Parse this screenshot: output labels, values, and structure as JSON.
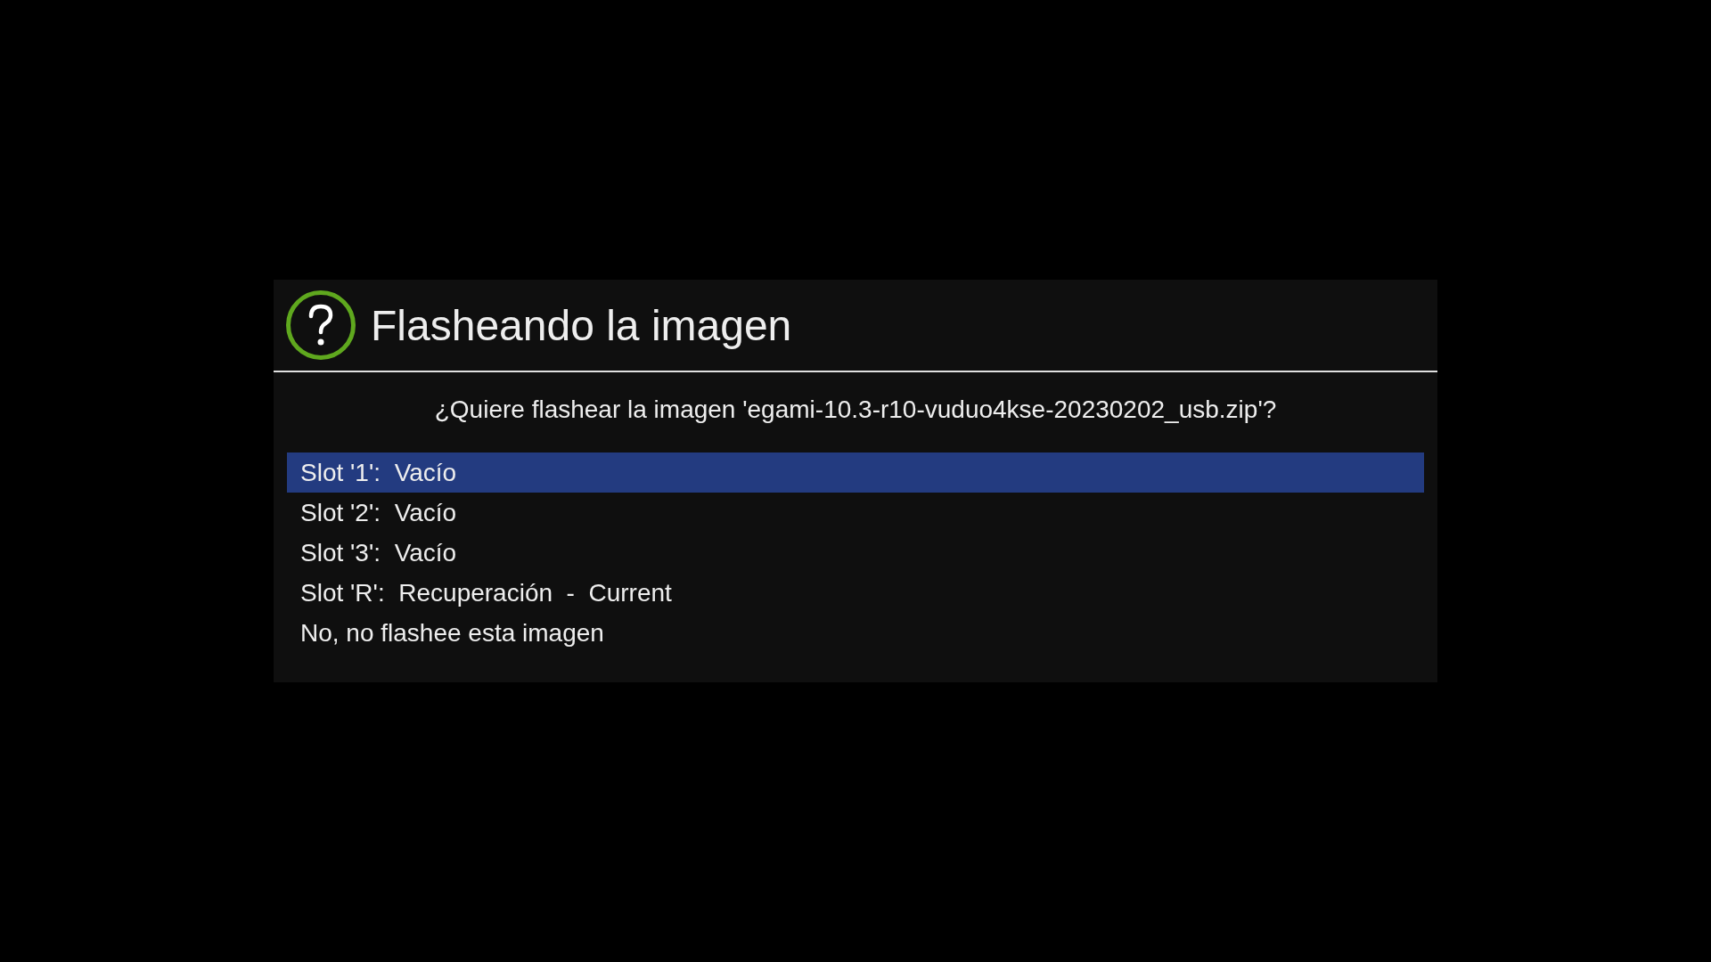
{
  "dialog": {
    "title": "Flasheando la imagen",
    "question": "¿Quiere flashear la imagen 'egami-10.3-r10-vuduo4kse-20230202_usb.zip'?",
    "options": [
      {
        "label": "Slot '1':  Vacío",
        "selected": true
      },
      {
        "label": "Slot '2':  Vacío",
        "selected": false
      },
      {
        "label": "Slot '3':  Vacío",
        "selected": false
      },
      {
        "label": "Slot 'R':  Recuperación  -  Current",
        "selected": false
      },
      {
        "label": "No, no flashee esta imagen",
        "selected": false
      }
    ]
  }
}
